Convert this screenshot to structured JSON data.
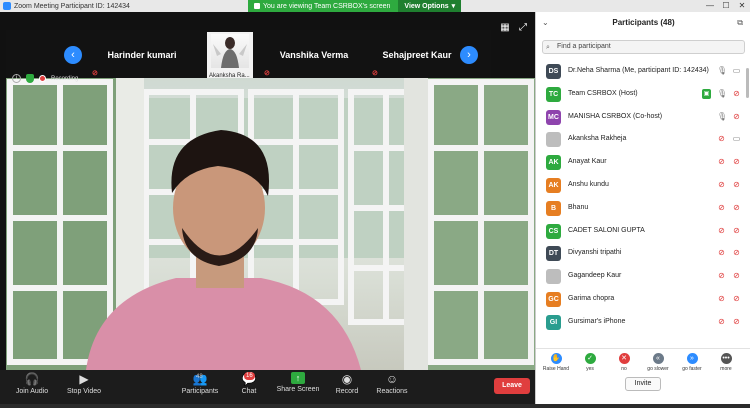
{
  "window": {
    "title": "Zoom Meeting Participant ID: 142434"
  },
  "banner": {
    "viewing": "You are viewing Team CSRBOX's screen",
    "options": "View Options"
  },
  "strip": {
    "tiles": [
      {
        "name": "Harinder kumari"
      },
      {
        "name": "Akanksha Ra..."
      },
      {
        "name": "Vanshika Verma"
      },
      {
        "name": "Sehajpreet Kaur"
      }
    ]
  },
  "status": {
    "recording": "Recording"
  },
  "toolbar": {
    "join_audio": "Join Audio",
    "stop_video": "Stop Video",
    "participants": "Participants",
    "participants_count": "48",
    "chat": "Chat",
    "chat_badge": "16",
    "share_screen": "Share Screen",
    "record": "Record",
    "reactions": "Reactions",
    "leave": "Leave"
  },
  "panel": {
    "title": "Participants (48)",
    "search_placeholder": "Find a participant",
    "participants": [
      {
        "initials": "DS",
        "name": "Dr.Neha Sharma (Me, participant ID: 142434)",
        "color": "#3f4a56"
      },
      {
        "initials": "TC",
        "name": "Team CSRBOX (Host)",
        "color": "#2eaa3f"
      },
      {
        "initials": "MC",
        "name": "MANISHA CSRBOX (Co-host)",
        "color": "#8e44ad"
      },
      {
        "initials": "",
        "name": "Akanksha Rakheja",
        "color": "#bdbdbd"
      },
      {
        "initials": "AK",
        "name": "Anayat Kaur",
        "color": "#2eaa3f"
      },
      {
        "initials": "AK",
        "name": "Anshu kundu",
        "color": "#e67e22"
      },
      {
        "initials": "B",
        "name": "Bhanu",
        "color": "#e67e22"
      },
      {
        "initials": "CS",
        "name": "CADET SALONI GUPTA",
        "color": "#2eaa3f"
      },
      {
        "initials": "DT",
        "name": "Divyanshi tripathi",
        "color": "#3f4a56"
      },
      {
        "initials": "",
        "name": "Gagandeep Kaur",
        "color": "#bdbdbd"
      },
      {
        "initials": "GC",
        "name": "Garima chopra",
        "color": "#e67e22"
      },
      {
        "initials": "GI",
        "name": "Gursimar's iPhone",
        "color": "#2a9d8f"
      }
    ],
    "reactions": [
      {
        "label": "Raise Hand",
        "color": "#2d8cff",
        "glyph": "✋"
      },
      {
        "label": "yes",
        "color": "#2eaa3f",
        "glyph": "✓"
      },
      {
        "label": "no",
        "color": "#e03e3e",
        "glyph": "✕"
      },
      {
        "label": "go slower",
        "color": "#6c7a89",
        "glyph": "«"
      },
      {
        "label": "go faster",
        "color": "#2d8cff",
        "glyph": "»"
      },
      {
        "label": "more",
        "color": "#555555",
        "glyph": "•••"
      }
    ],
    "invite": "Invite"
  }
}
